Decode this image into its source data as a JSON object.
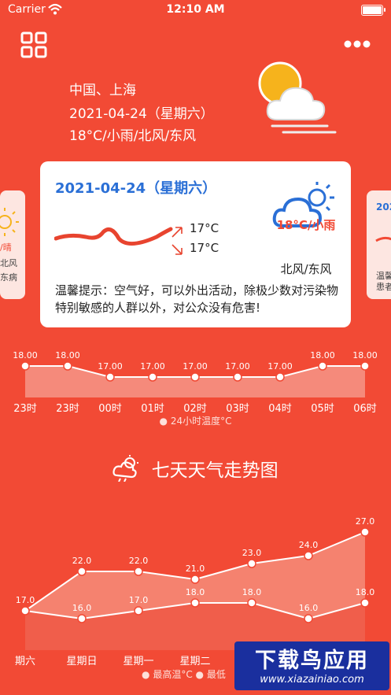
{
  "status": {
    "carrier": "Carrier",
    "time": "12:10 AM"
  },
  "location": {
    "place": "中国、上海",
    "date": "2021-04-24（星期六）",
    "summary": "18°C/小雨/北风/东风"
  },
  "card": {
    "date": "2021-04-24（星期六）",
    "temp_high": "17°C",
    "temp_low": "17°C",
    "weather": "18°C/小雨",
    "wind": "北风/东风",
    "tip": "温馨提示：空气好，可以外出活动，除极少数对污染物特别敏感的人群以外，对公众没有危害!"
  },
  "side_left": {
    "lines": [
      "/晴",
      "北风",
      "东病"
    ]
  },
  "side_right": {
    "lines": [
      "202",
      "温馨",
      "患者"
    ]
  },
  "hourly": {
    "legend": "24小时温度°C",
    "labels": [
      "23时",
      "23时",
      "00时",
      "01时",
      "02时",
      "03时",
      "04时",
      "05时",
      "06时",
      ""
    ],
    "values": [
      "18.00",
      "18.00",
      "17.00",
      "17.00",
      "17.00",
      "17.00",
      "17.00",
      "18.00",
      "18.00"
    ],
    "numeric": [
      18,
      18,
      17,
      17,
      17,
      17,
      17,
      18,
      18
    ]
  },
  "seven": {
    "title": "七天天气走势图",
    "legend_high": "最高温°C",
    "legend_low": "最低",
    "days": [
      "期六",
      "星期日",
      "星期一",
      "星期二",
      "",
      "",
      ""
    ],
    "high_labels": [
      "17.0",
      "22.0",
      "22.0",
      "21.0",
      "23.0",
      "24.0",
      "27.0"
    ],
    "low_labels": [
      "",
      "16.0",
      "17.0",
      "18.0",
      "18.0",
      "16.0",
      "18.0"
    ],
    "high": [
      17,
      22,
      22,
      21,
      23,
      24,
      27
    ],
    "low": [
      17,
      16,
      17,
      18,
      18,
      16,
      18
    ]
  },
  "watermark": {
    "line1": "下载鸟应用",
    "line2": "www.xiazainiao.com"
  },
  "colors": {
    "bg": "#f24a35",
    "accent_blue": "#2a6fd6",
    "sun": "#f6b31c"
  }
}
